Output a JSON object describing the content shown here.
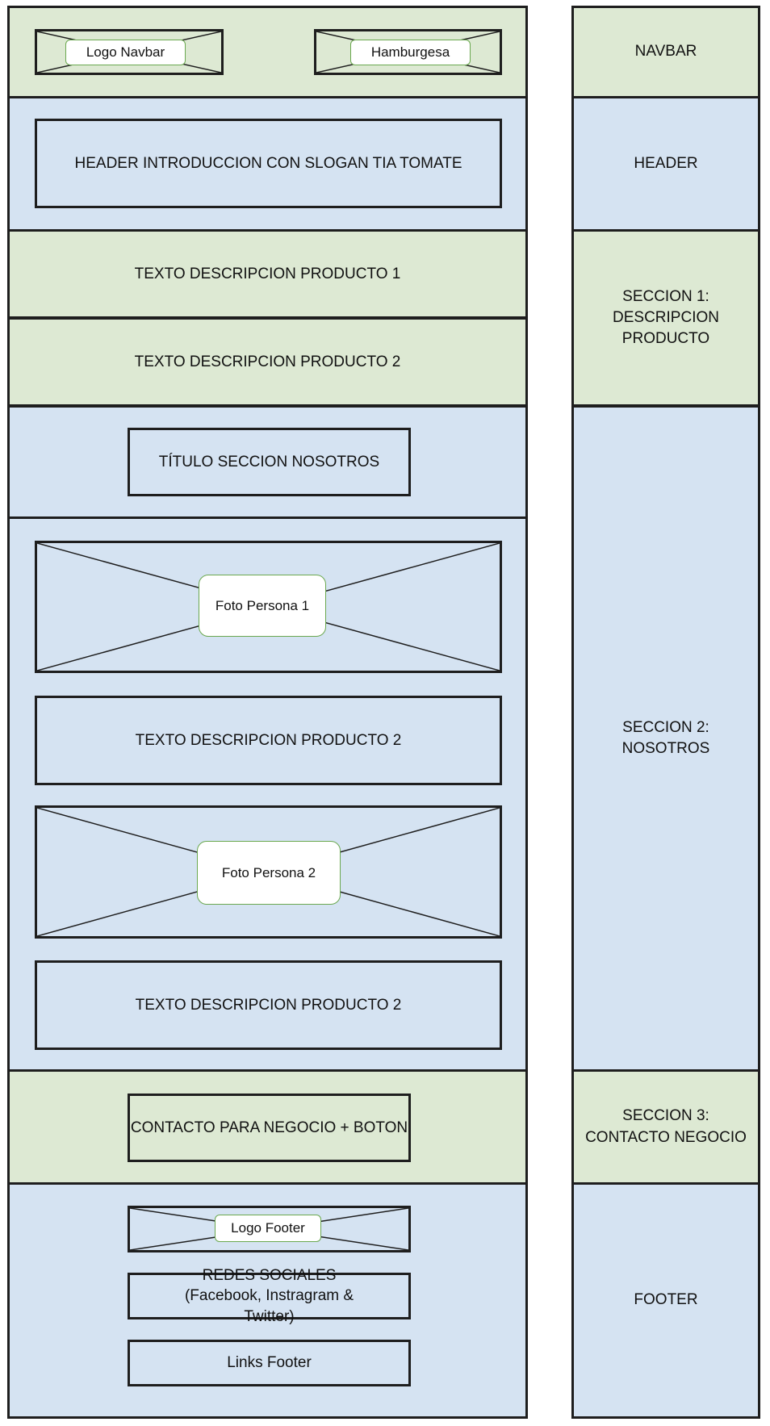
{
  "wireframe": {
    "navbar": {
      "logo_label": "Logo Navbar",
      "menu_label": "Hamburgesa"
    },
    "header": {
      "intro_text": "HEADER INTRODUCCION CON SLOGAN TIA TOMATE"
    },
    "section1": {
      "text1": "TEXTO DESCRIPCION PRODUCTO 1",
      "text2": "TEXTO DESCRIPCION PRODUCTO 2"
    },
    "section2": {
      "title": "TÍTULO SECCION NOSOTROS",
      "photo1_label": "Foto Persona 1",
      "text1": "TEXTO DESCRIPCION PRODUCTO 2",
      "photo2_label": "Foto Persona 2",
      "text2": "TEXTO DESCRIPCION PRODUCTO 2"
    },
    "section3": {
      "contact_text": "CONTACTO PARA NEGOCIO + BOTON"
    },
    "footer": {
      "logo_label": "Logo Footer",
      "social_text": "REDES SOCIALES (Facebook, Instragram & Twitter)",
      "links_text": "Links Footer"
    }
  },
  "legend": {
    "navbar": "NAVBAR",
    "header": "HEADER",
    "section1": "SECCION 1: DESCRIPCION PRODUCTO",
    "section2": "SECCION 2: NOSOTROS",
    "section3": "SECCION 3: CONTACTO NEGOCIO",
    "footer": "FOOTER"
  },
  "colors": {
    "green_fill": "#dde9d3",
    "blue_fill": "#d5e3f2",
    "outline": "#1e1e1e",
    "label_border": "#6aa84f"
  }
}
